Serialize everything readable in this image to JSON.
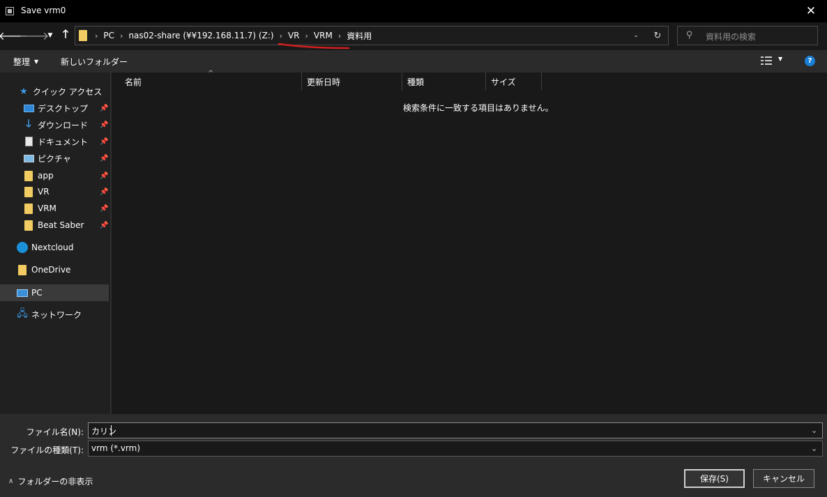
{
  "window": {
    "title": "Save vrm0",
    "close_glyph": "✕"
  },
  "nav": {
    "back_glyph": "🡐",
    "forward_glyph": "🡒",
    "recent_glyph": "▼",
    "up_glyph": "🡑"
  },
  "address": {
    "breadcrumbs": [
      "PC",
      "nas02-share (¥¥192.168.11.7) (Z:)",
      "VR",
      "VRM",
      "資料用"
    ],
    "separator": "›",
    "dropdown_glyph": "⌄",
    "refresh_glyph": "↻",
    "highlight_color": "#d21f1f"
  },
  "search": {
    "placeholder": "資料用の検索",
    "icon": "search-icon"
  },
  "toolbar": {
    "organize_label": "整理",
    "organize_dd": "▼",
    "new_folder_label": "新しいフォルダー",
    "view_dd": "▼",
    "help_glyph": "?"
  },
  "sidebar": {
    "quick_access": "クイック アクセス",
    "items": [
      {
        "label": "デスクトップ",
        "icon": "desktop-icon",
        "pinned": true
      },
      {
        "label": "ダウンロード",
        "icon": "download-icon",
        "pinned": true
      },
      {
        "label": "ドキュメント",
        "icon": "document-icon",
        "pinned": true
      },
      {
        "label": "ピクチャ",
        "icon": "pictures-icon",
        "pinned": true
      },
      {
        "label": "app",
        "icon": "folder-icon",
        "pinned": true
      },
      {
        "label": "VR",
        "icon": "folder-icon",
        "pinned": true
      },
      {
        "label": "VRM",
        "icon": "folder-icon",
        "pinned": true
      },
      {
        "label": "Beat Saber",
        "icon": "folder-icon",
        "pinned": true
      }
    ],
    "nextcloud": "Nextcloud",
    "onedrive": "OneDrive",
    "pc": "PC",
    "network": "ネットワーク",
    "pin_glyph": "📌"
  },
  "filelist": {
    "columns": [
      "名前",
      "更新日時",
      "種類",
      "サイズ"
    ],
    "sort_glyph": "^",
    "empty_message": "検索条件に一致する項目はありません。"
  },
  "form": {
    "filename_label": "ファイル名(N):",
    "filename_value": "カリン",
    "filetype_label": "ファイルの種類(T):",
    "filetype_value": "vrm (*.vrm)",
    "dd_glyph": "⌄",
    "hide_folders_label": "フォルダーの非表示",
    "hide_folders_glyph": "∧",
    "save_label": "保存(S)",
    "cancel_label": "キャンセル"
  }
}
